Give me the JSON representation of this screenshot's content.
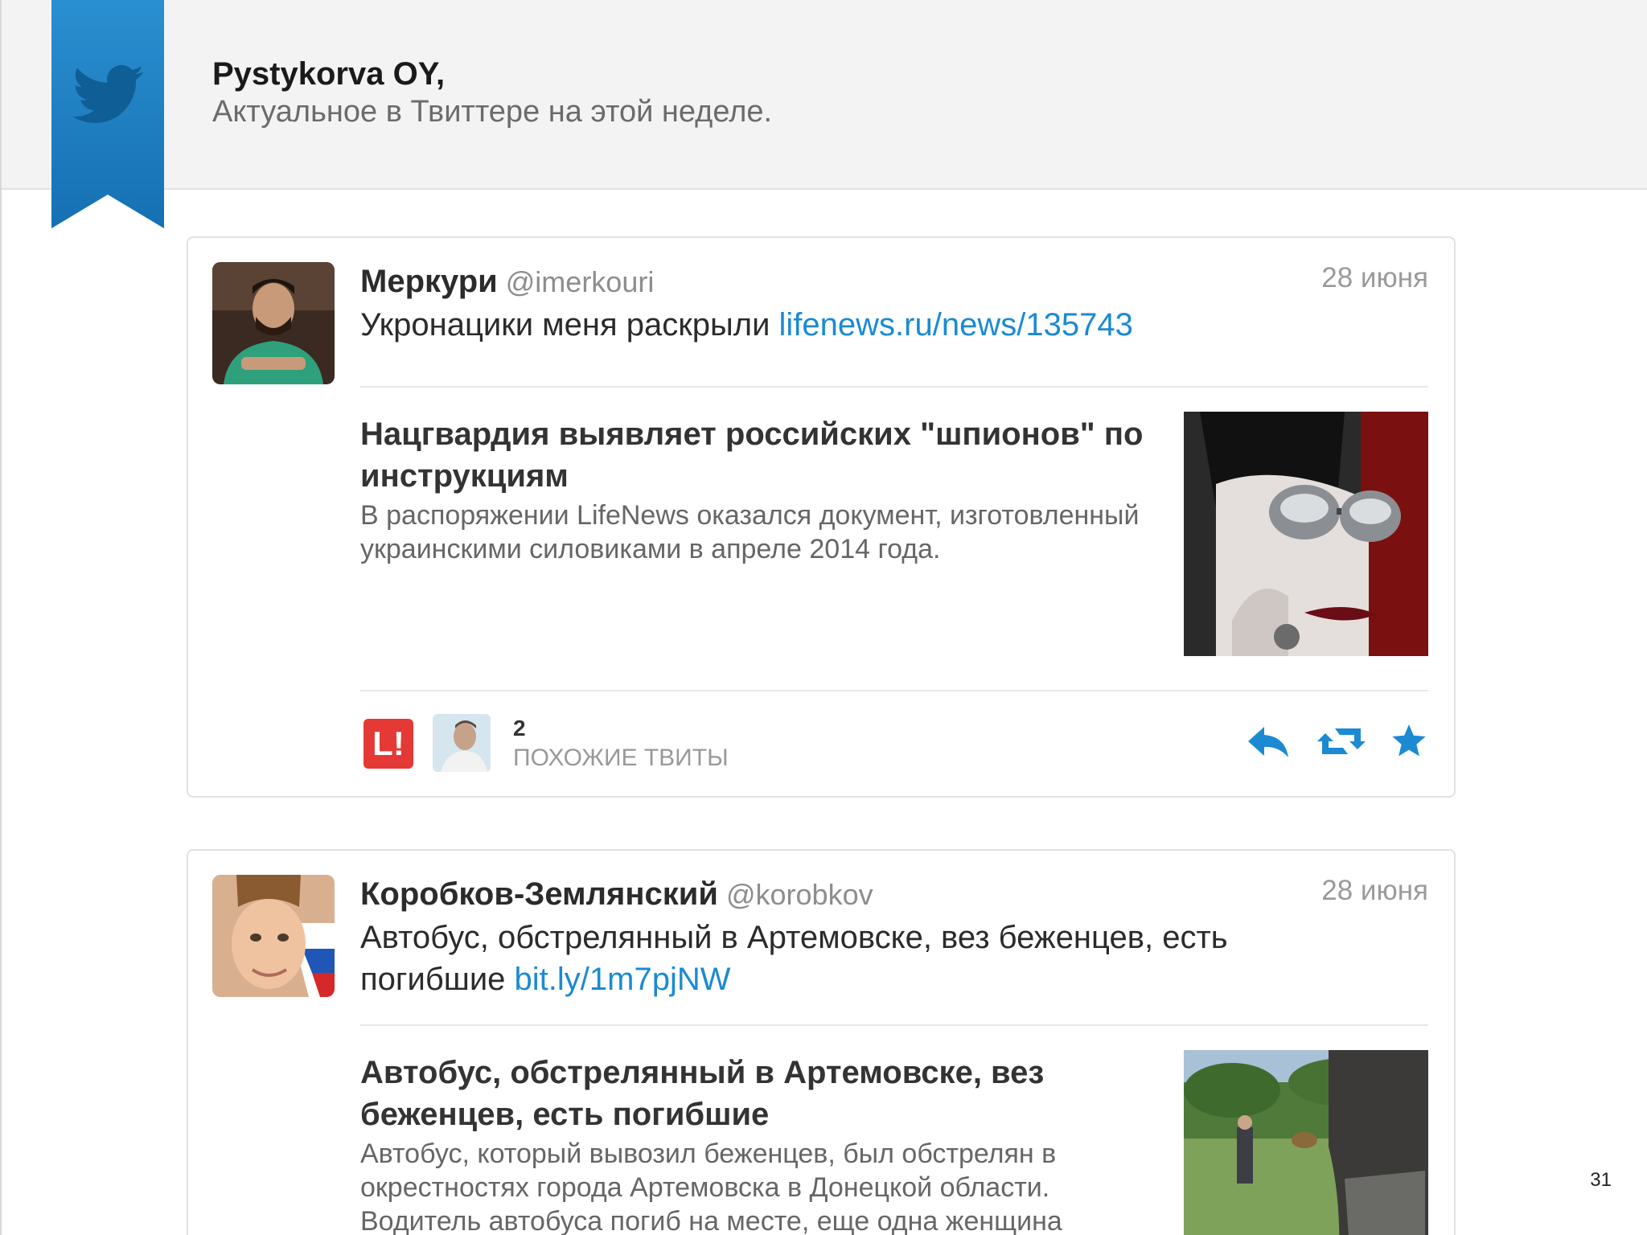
{
  "header": {
    "recipient": "Pystykorva OY,",
    "subtitle": "Актуальное в Твиттере на этой неделе."
  },
  "colors": {
    "ribbon": "#1a7cc1",
    "link": "#1b8ad3",
    "action_icons": "#1b8ad3",
    "lifenews_badge": "#e53935"
  },
  "icons": {
    "ribbon_logo": "twitter-bird-icon",
    "reply": "reply-icon",
    "retweet": "retweet-icon",
    "favorite": "star-icon"
  },
  "tweets": [
    {
      "name": "Меркури",
      "handle": "@imerkouri",
      "date": "28 июня",
      "text": "Укронацики меня раскрыли ",
      "link": "lifenews.ru/news/135743",
      "card": {
        "title": "Нацгвардия выявляет российских \"шпионов\" по инструкциям",
        "body": "В распоряжении LifeNews оказался документ, изготовленный украинскими силовиками в апреле 2014 года."
      },
      "footer": {
        "lifenews_badge": "L!",
        "similar_count": "2",
        "similar_label": "ПОХОЖИЕ ТВИТЫ"
      }
    },
    {
      "name": "Коробков-Землянский",
      "handle": "@korobkov",
      "date": "28 июня",
      "text": "Автобус, обстрелянный в Артемовске, вез беженцев, есть погибшие ",
      "link": "bit.ly/1m7pjNW",
      "card": {
        "title": "Автобус, обстрелянный в Артемовске, вез беженцев, есть погибшие",
        "body": "Автобус, который вывозил беженцев, был обстрелян в окрестностях города Артемовска в Донецкой области. Водитель автобуса погиб на месте, еще одна женщина"
      }
    }
  ],
  "page_number": "31"
}
